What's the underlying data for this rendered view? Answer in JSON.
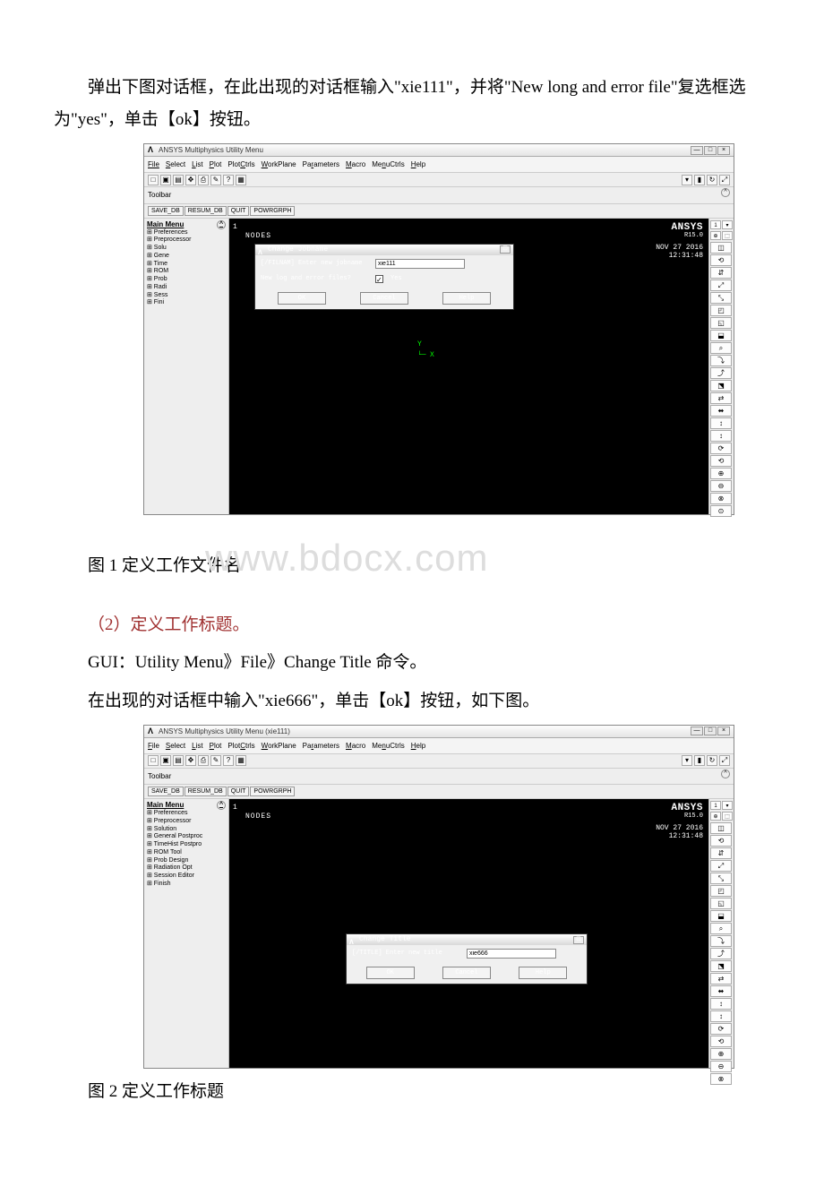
{
  "intro_para": "弹出下图对话框，在此出现的对话框输入\"xie111\"，并将\"New long and error file\"复选框选为\"yes\"，单击【ok】按钮。",
  "caption1": "图 1 定义工作文件名",
  "watermark": "www.bdocx.com",
  "step2": "（2）定义工作标题。",
  "gui_line": "GUI：Utility Menu》File》Change Title 命令。",
  "para2": "在出现的对话框中输入\"xie666\"，单击【ok】按钮，如下图。",
  "caption2": "图 2 定义工作标题",
  "ansys": {
    "title1": "ANSYS Multiphysics Utility Menu",
    "title2": "ANSYS Multiphysics Utility Menu (xie111)",
    "menubar": [
      "File",
      "Select",
      "List",
      "Plot",
      "PlotCtrls",
      "WorkPlane",
      "Parameters",
      "Macro",
      "MenuCtrls",
      "Help"
    ],
    "toolbar_label": "Toolbar",
    "save_buttons": [
      "SAVE_DB",
      "RESUM_DB",
      "QUIT",
      "POWRGRPH"
    ],
    "main_menu_label": "Main Menu",
    "main_menu_items_short": [
      "⊞ Preferences",
      "⊞ Preprocessor",
      "⊞ Solu",
      "⊞ Gene",
      "⊞ Time",
      "⊞ ROM",
      "⊞ Prob",
      "⊞ Radi",
      "⊞ Sess",
      "⊞ Fini"
    ],
    "main_menu_items_full": [
      "⊞ Preferences",
      "⊞ Preprocessor",
      "⊞ Solution",
      "⊞ General Postproc",
      "⊞ TimeHist Postpro",
      "⊞ ROM Tool",
      "⊞ Prob Design",
      "⊞ Radiation Opt",
      "⊞ Session Editor",
      "⊞ Finish"
    ],
    "graphics": {
      "top_num": "1",
      "nodes": "NODES",
      "brand": "ANSYS",
      "version": "R15.0",
      "date": "NOV 27 2016",
      "time": "12:31:48",
      "y": "Y",
      "x": "X"
    },
    "side_icons_top": [
      "1",
      "",
      "",
      ""
    ],
    "side_icons": [
      "⊕",
      "⬚",
      "◫",
      "⟲",
      "⇵",
      "⤢",
      "⤡",
      "◰",
      "◱",
      "⬓",
      "⌕",
      "⤵",
      "⤴",
      "⬔",
      "⇄",
      "⬌",
      "↕",
      "↕",
      "⟳",
      "⟲",
      "⊕",
      "⊖",
      "⊗",
      "⊙"
    ],
    "dialog1": {
      "title": "Change Jobname",
      "label1": "[/FILNAM] Enter new jobname",
      "value1": "xie111",
      "label2": "New log and error files?",
      "chk_label": "Yes",
      "ok": "OK",
      "cancel": "Cancel",
      "help": "Help"
    },
    "dialog2": {
      "title": "Change Title",
      "label1": "[/TITLE] Enter new title",
      "value1": "xie666",
      "ok": "OK",
      "cancel": "Cancel",
      "help": "Help"
    }
  }
}
